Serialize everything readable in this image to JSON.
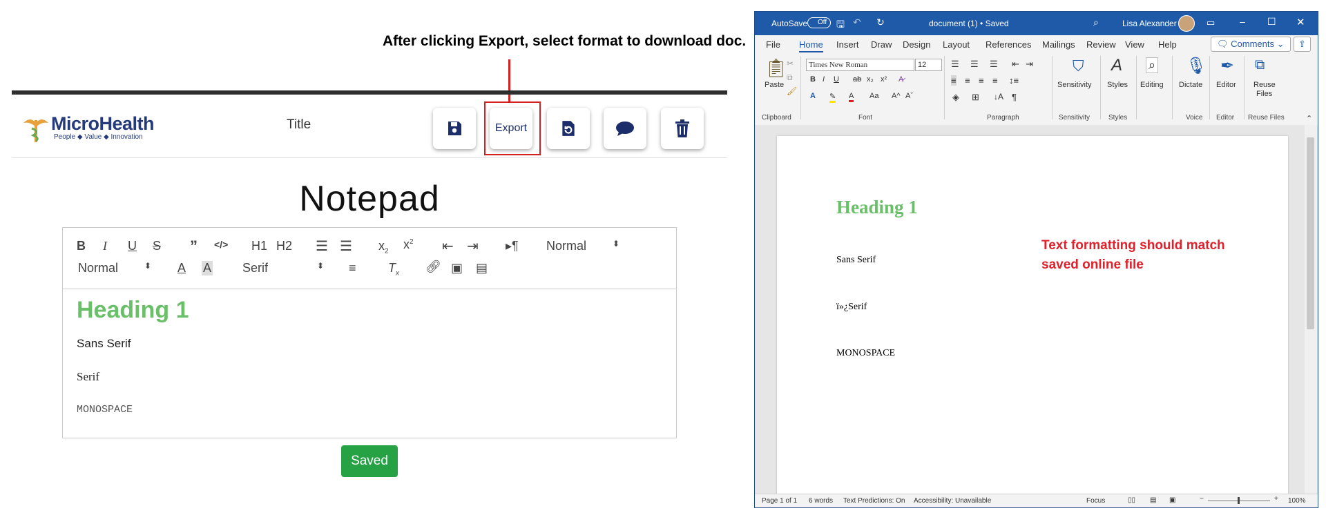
{
  "annotations": {
    "top": "After clicking Export, select format to download doc.",
    "right_line1": "Text formatting should match",
    "right_line2": "saved online file"
  },
  "app": {
    "logo_name": "MicroHealth",
    "logo_tagline": "People ◆ Value ◆ Innovation",
    "title_label": "Title",
    "export_label": "Export",
    "page_title": "Notepad",
    "saved_label": "Saved"
  },
  "editor_toolbar": {
    "h1": "H1",
    "h2": "H2",
    "header_select": "Normal",
    "size_select": "Normal",
    "font_select": "Serif"
  },
  "editor_content": {
    "heading": "Heading 1",
    "sans": "Sans Serif",
    "serif": "Serif",
    "mono": "MONOSPACE"
  },
  "colors": {
    "heading_green": "#6abf69",
    "saved_green": "#26a244",
    "annotation_red": "#d62020",
    "word_blue": "#1f5aa8",
    "icon_navy": "#1c2d6b"
  },
  "word": {
    "autosave": "AutoSave",
    "autosave_state": "Off",
    "doc_title": "document (1) • Saved",
    "user": "Lisa Alexander",
    "tabs": [
      "File",
      "Home",
      "Insert",
      "Draw",
      "Design",
      "Layout",
      "References",
      "Mailings",
      "Review",
      "View",
      "Help"
    ],
    "comments": "Comments",
    "font_name": "Times New Roman",
    "font_size": "12",
    "paste": "Paste",
    "groups": {
      "clipboard": "Clipboard",
      "font": "Font",
      "paragraph": "Paragraph",
      "sensitivity": "Sensitivity",
      "styles": "Styles",
      "voice": "Voice",
      "editor": "Editor",
      "reuse": "Reuse Files"
    },
    "buttons": {
      "sensitivity": "Sensitivity",
      "styles": "Styles",
      "editing": "Editing",
      "dictate": "Dictate",
      "editor": "Editor",
      "reuse1": "Reuse",
      "reuse2": "Files"
    },
    "doc": {
      "heading": "Heading 1",
      "sans": "Sans Serif",
      "serif": "ï»¿Serif",
      "mono": "MONOSPACE"
    },
    "status": {
      "page": "Page 1 of 1",
      "words": "6 words",
      "predictions": "Text Predictions: On",
      "accessibility": "Accessibility: Unavailable",
      "focus": "Focus",
      "zoom": "100%"
    }
  }
}
